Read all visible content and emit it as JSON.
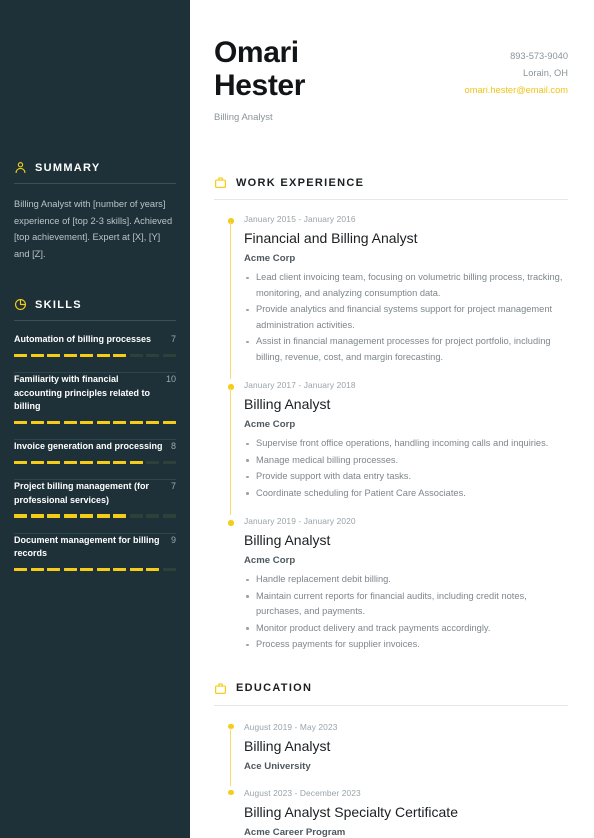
{
  "theme": {
    "sidebar_bg": "#1e3138",
    "accent_yellow": "#f5cd19",
    "text_dark": "#1b1f22",
    "text_muted": "#7d878c"
  },
  "header": {
    "first_name": "Omari",
    "last_name": "Hester",
    "job_title": "Billing Analyst",
    "phone": "893-573-9040",
    "location": "Lorain, OH",
    "email": "omari.hester@email.com"
  },
  "sidebar": {
    "summary": {
      "icon": "user-icon",
      "title": "SUMMARY",
      "text": "Billing Analyst with [number of years] experience of [top 2-3 skills]. Achieved [top achievement]. Expert at [X], [Y] and [Z]."
    },
    "skills": {
      "icon": "pie-chart-icon",
      "title": "SKILLS",
      "max_score": 10,
      "items": [
        {
          "name": "Automation of billing processes",
          "score": 7
        },
        {
          "name": "Familiarity with financial accounting principles related to billing",
          "score": 10
        },
        {
          "name": "Invoice generation and processing",
          "score": 8
        },
        {
          "name": "Project billing management (for professional services)",
          "score": 7
        },
        {
          "name": "Document management for billing records",
          "score": 9
        }
      ]
    }
  },
  "main": {
    "work": {
      "icon": "briefcase-icon",
      "title": "WORK EXPERIENCE",
      "entries": [
        {
          "date": "January 2015 - January 2016",
          "title": "Financial and Billing Analyst",
          "org": "Acme Corp",
          "bullets": [
            "Lead client invoicing team, focusing on volumetric billing process, tracking, monitoring, and analyzing consumption data.",
            "Provide analytics and financial systems support for project management administration activities.",
            "Assist in financial management processes for project portfolio, including billing, revenue, cost, and margin forecasting."
          ]
        },
        {
          "date": "January 2017 - January 2018",
          "title": "Billing Analyst",
          "org": "Acme Corp",
          "bullets": [
            "Supervise front office operations, handling incoming calls and inquiries.",
            "Manage medical billing processes.",
            "Provide support with data entry tasks.",
            "Coordinate scheduling for Patient Care Associates."
          ]
        },
        {
          "date": "January 2019 - January 2020",
          "title": "Billing Analyst",
          "org": "Acme Corp",
          "bullets": [
            "Handle replacement debit billing.",
            "Maintain current reports for financial audits, including credit notes, purchases, and payments.",
            "Monitor product delivery and track payments accordingly.",
            "Process payments for supplier invoices."
          ]
        }
      ]
    },
    "education": {
      "icon": "briefcase-icon",
      "title": "EDUCATION",
      "entries": [
        {
          "date": "August 2019 - May 2023",
          "title": "Billing Analyst",
          "org": "Ace University"
        },
        {
          "date": "August 2023 - December 2023",
          "title": "Billing Analyst Specialty Certificate",
          "org": "Acme Career Program"
        }
      ]
    }
  }
}
